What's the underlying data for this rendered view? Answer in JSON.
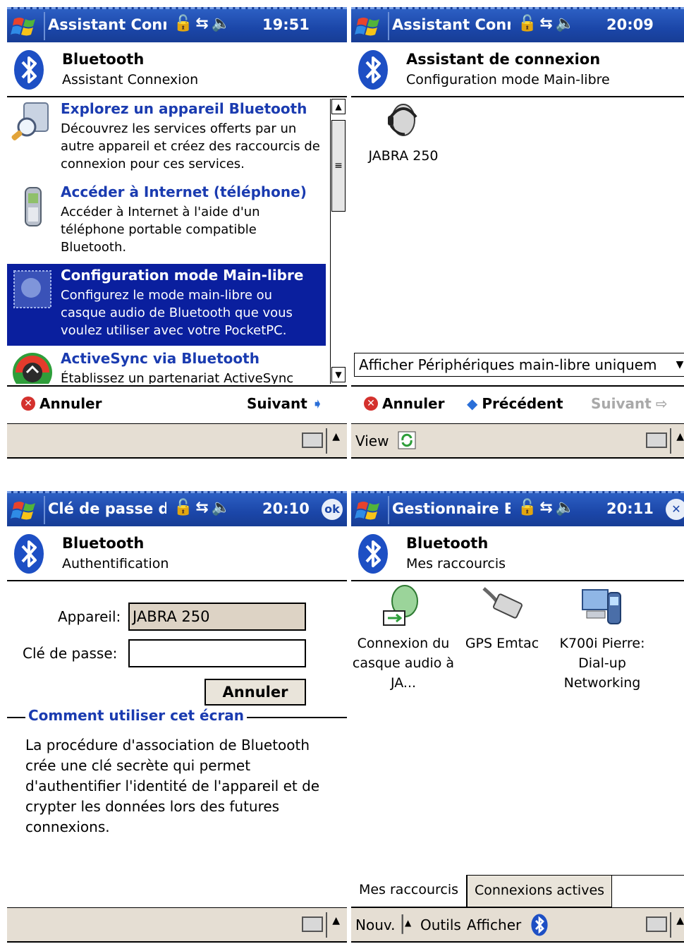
{
  "colors": {
    "titlebar": "#1b46a8",
    "selection": "#0a1f9e",
    "link": "#1a3bb0",
    "menubar": "#e5ded3",
    "cancel": "#d4312d"
  },
  "screens": [
    {
      "title": "Assistant Conne",
      "time": "19:51",
      "header": {
        "title": "Bluetooth",
        "subtitle": "Assistant Connexion"
      },
      "items": [
        {
          "icon": "magnifier-device-icon",
          "title": "Explorez un appareil Bluetooth",
          "desc": "Découvrez les services offerts par un autre appareil et créez des raccourcis de connexion pour ces services.",
          "selected": false
        },
        {
          "icon": "mobile-phone-icon",
          "title": "Accéder à Internet (téléphone)",
          "desc": "Accéder à Internet à l'aide d'un téléphone portable compatible Bluetooth.",
          "selected": false
        },
        {
          "icon": "handsfree-icon",
          "title": "Configuration mode Main-libre",
          "desc": "Configurez le mode main-libre ou casque audio de Bluetooth que vous voulez utiliser avec votre PocketPC.",
          "selected": true
        },
        {
          "icon": "activesync-icon",
          "title": "ActiveSync via Bluetooth",
          "desc": "Établissez un partenariat ActiveSync",
          "selected": false
        }
      ],
      "cancel_label": "Annuler",
      "next_label": "Suivant"
    },
    {
      "title": "Assistant Conne",
      "time": "20:09",
      "header": {
        "title": "Assistant de connexion",
        "subtitle": "Configuration mode Main-libre"
      },
      "device_label": "JABRA 250",
      "dropdown_value": "Afficher Périphériques main-libre uniquem",
      "cancel_label": "Annuler",
      "prev_label": "Précédent",
      "next_label": "Suivant",
      "menu_view": "View"
    },
    {
      "title": "Clé de passe de l",
      "time": "20:10",
      "ok_label": "ok",
      "header": {
        "title": "Bluetooth",
        "subtitle": "Authentification"
      },
      "device_field_label": "Appareil:",
      "device_field_value": "JABRA 250",
      "passkey_label": "Clé de passe:",
      "passkey_value": "",
      "cancel_label": "Annuler",
      "help_title": "Comment utiliser cet écran",
      "help_text": "La procédure d'association de Bluetooth crée une clé secrète qui permet d'authentifier l'identité de l'appareil et de crypter les données lors des futures connexions."
    },
    {
      "title": "Gestionnaire Blu",
      "time": "20:11",
      "header": {
        "title": "Bluetooth",
        "subtitle": "Mes raccourcis"
      },
      "shortcuts": [
        {
          "icon": "headset-connection-icon",
          "label": "Connexion du casque audio à JA..."
        },
        {
          "icon": "serial-cable-icon",
          "label": "GPS Emtac"
        },
        {
          "icon": "phone-computer-icon",
          "label": "K700i Pierre: Dial-up Networking"
        }
      ],
      "tabs": [
        "Mes raccourcis",
        "Connexions actives"
      ],
      "menu": {
        "new": "Nouv.",
        "tools": "Outils",
        "view": "Afficher"
      }
    }
  ]
}
